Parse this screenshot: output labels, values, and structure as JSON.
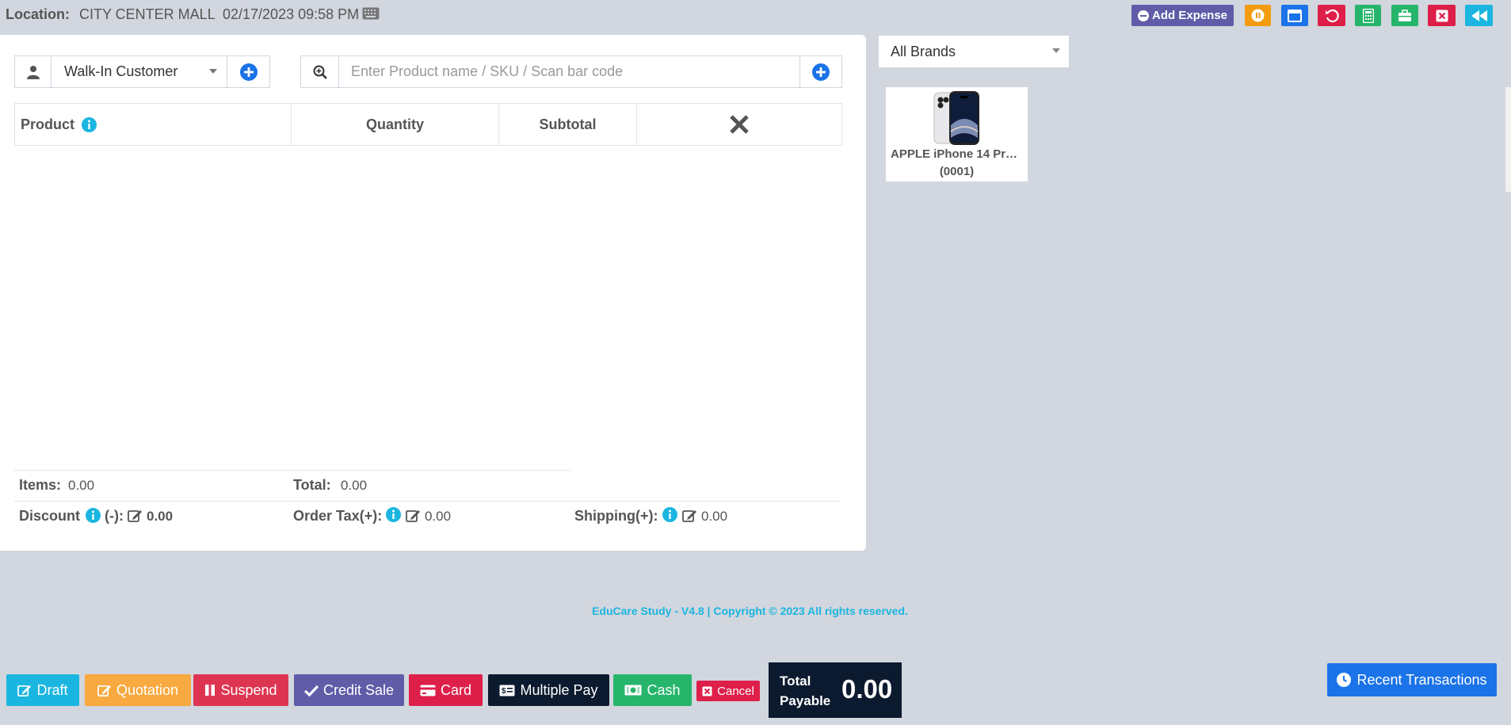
{
  "header": {
    "location_label": "Location:",
    "location_value": "CITY CENTER MALL",
    "datetime": "02/17/2023 09:58 PM",
    "add_expense_label": "Add Expense"
  },
  "customer": {
    "selected": "Walk-In Customer"
  },
  "search": {
    "placeholder": "Enter Product name / SKU / Scan bar code"
  },
  "table": {
    "columns": {
      "product": "Product",
      "quantity": "Quantity",
      "subtotal": "Subtotal"
    }
  },
  "totals": {
    "items_label": "Items:",
    "items_value": "0.00",
    "total_label": "Total:",
    "total_value": "0.00",
    "discount_label": "Discount",
    "discount_suffix": "(-):",
    "discount_value": "0.00",
    "order_tax_label": "Order Tax(+):",
    "order_tax_value": "0.00",
    "shipping_label": "Shipping(+):",
    "shipping_value": "0.00"
  },
  "brands": {
    "selected": "All Brands"
  },
  "products": [
    {
      "name": "APPLE iPhone 14 Pro Max",
      "sku": "(0001)"
    }
  ],
  "footer": {
    "text": "EduCare Study - V4.8 | Copyright © 2023 All rights reserved."
  },
  "actions": {
    "draft": "Draft",
    "quotation": "Quotation",
    "suspend": "Suspend",
    "credit_sale": "Credit Sale",
    "card": "Card",
    "multiple_pay": "Multiple Pay",
    "cash": "Cash",
    "cancel": "Cancel"
  },
  "total_payable": {
    "label_line1": "Total",
    "label_line2": "Payable",
    "value": "0.00"
  },
  "recent_transactions": "Recent Transactions",
  "colors": {
    "background": "#d2d6de",
    "purple": "#605ca8",
    "blue": "#1a73e8",
    "red": "#dd1f4a",
    "green": "#26b56b",
    "cyan": "#1ab6e0",
    "orange": "#f39c12",
    "navy": "#0c1a2f"
  }
}
